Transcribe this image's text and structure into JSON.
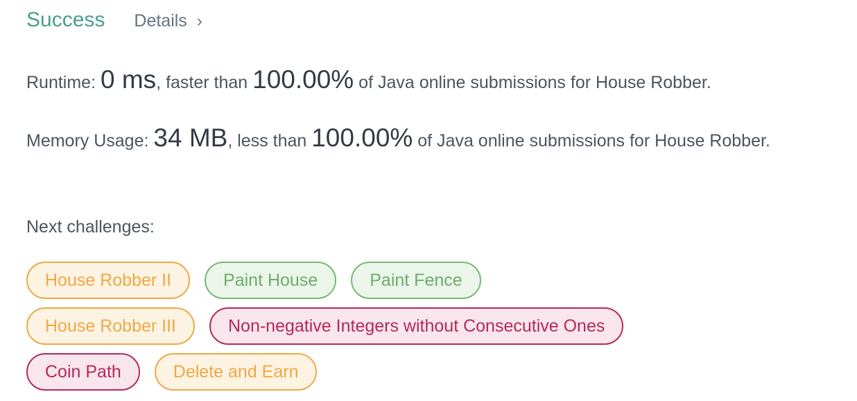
{
  "header": {
    "status": "Success",
    "details_label": "Details",
    "chevron": "›"
  },
  "runtime": {
    "label": "Runtime: ",
    "value": "0 ms",
    "mid": ", faster than ",
    "percent": "100.00%",
    "suffix": " of Java online submissions for House Robber."
  },
  "memory": {
    "label": "Memory Usage: ",
    "value": "34 MB",
    "mid": ", less than ",
    "percent": "100.00%",
    "suffix": " of Java online submissions for House Robber."
  },
  "next_label": "Next challenges:",
  "challenges": [
    {
      "label": "House Robber II",
      "difficulty": "medium"
    },
    {
      "label": "Paint House",
      "difficulty": "easy"
    },
    {
      "label": "Paint Fence",
      "difficulty": "easy"
    },
    {
      "label": "House Robber III",
      "difficulty": "medium"
    },
    {
      "label": "Non-negative Integers without Consecutive Ones",
      "difficulty": "hard"
    },
    {
      "label": "Coin Path",
      "difficulty": "hard"
    },
    {
      "label": "Delete and Earn",
      "difficulty": "medium"
    }
  ],
  "colors": {
    "success": "#4a9e8e",
    "medium": "#f0a844",
    "easy": "#77b971",
    "hard": "#b5285d"
  }
}
